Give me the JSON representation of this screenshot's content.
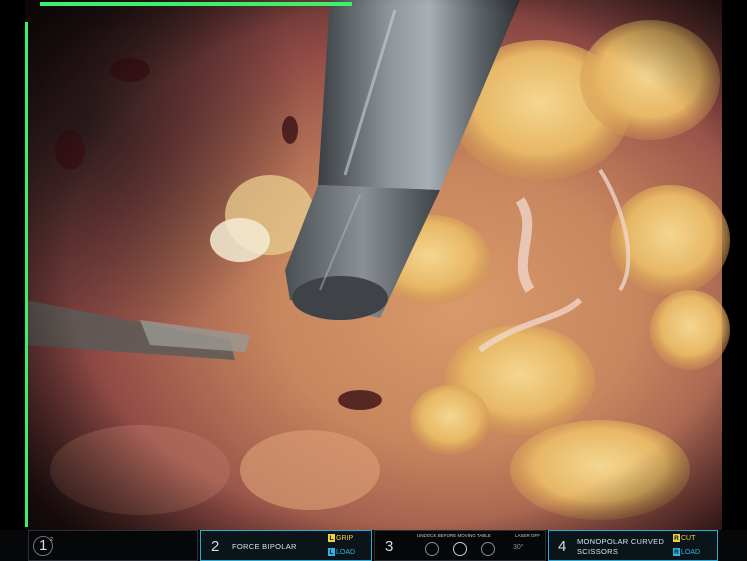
{
  "instruments": {
    "arm1": {
      "number": "1",
      "sub": "2"
    },
    "arm2": {
      "number": "2",
      "name": "FORCE BIPOLAR",
      "tag_top_letter": "L",
      "tag_top": "GRIP",
      "tag_bottom_letter": "L",
      "tag_bottom": "LOAD"
    },
    "camera": {
      "number": "3",
      "notice": "UNDOCK BEFORE MOVING TABLE",
      "laser": "LASER OFF",
      "angle": "30°"
    },
    "arm4": {
      "number": "4",
      "name_line1": "MONOPOLAR CURVED",
      "name_line2": "SCISSORS",
      "tag_top_letter": "R",
      "tag_top": "CUT",
      "tag_bottom_letter": "R",
      "tag_bottom": "LOAD"
    }
  },
  "colors": {
    "frame_indicator": "#3cf06a",
    "arm2_accent": "#28a9d8",
    "arm4_accent": "#28a9d8",
    "grip_tag": "#f0d23c",
    "cut_tag": "#f0d23c",
    "load_tag": "#2fb6e6"
  },
  "icons": [
    "camera-arm-icon",
    "scope-icon",
    "energy-pedal-icon"
  ]
}
